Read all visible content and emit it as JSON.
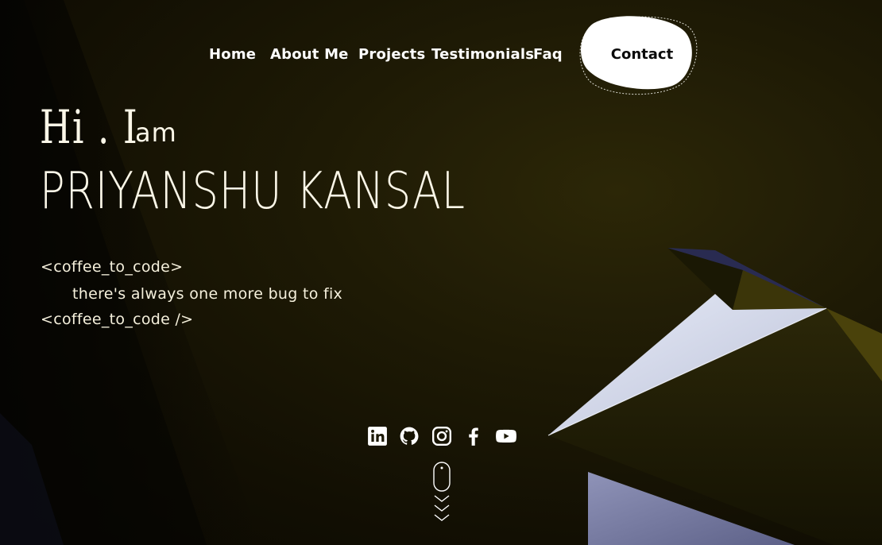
{
  "nav": {
    "items": [
      {
        "label": "Home"
      },
      {
        "label": "About Me"
      },
      {
        "label": "Projects"
      },
      {
        "label": "Testimonials"
      },
      {
        "label": "Faq"
      }
    ],
    "contact_label": "Contact"
  },
  "hero": {
    "greeting_hi": "Hi . I",
    "greeting_am": "am",
    "name": "PRIYANSHU KANSAL",
    "code_open": "<coffee_to_code>",
    "code_body": "there's always one more bug to fix",
    "code_close": "<coffee_to_code />"
  },
  "social": [
    {
      "icon": "linkedin-icon"
    },
    {
      "icon": "github-icon"
    },
    {
      "icon": "instagram-icon"
    },
    {
      "icon": "facebook-icon"
    },
    {
      "icon": "youtube-icon"
    }
  ],
  "colors": {
    "background": "#1e1a05",
    "text": "#ffffff",
    "contact_bg": "#ffffff",
    "contact_text": "#0b0b0b"
  }
}
